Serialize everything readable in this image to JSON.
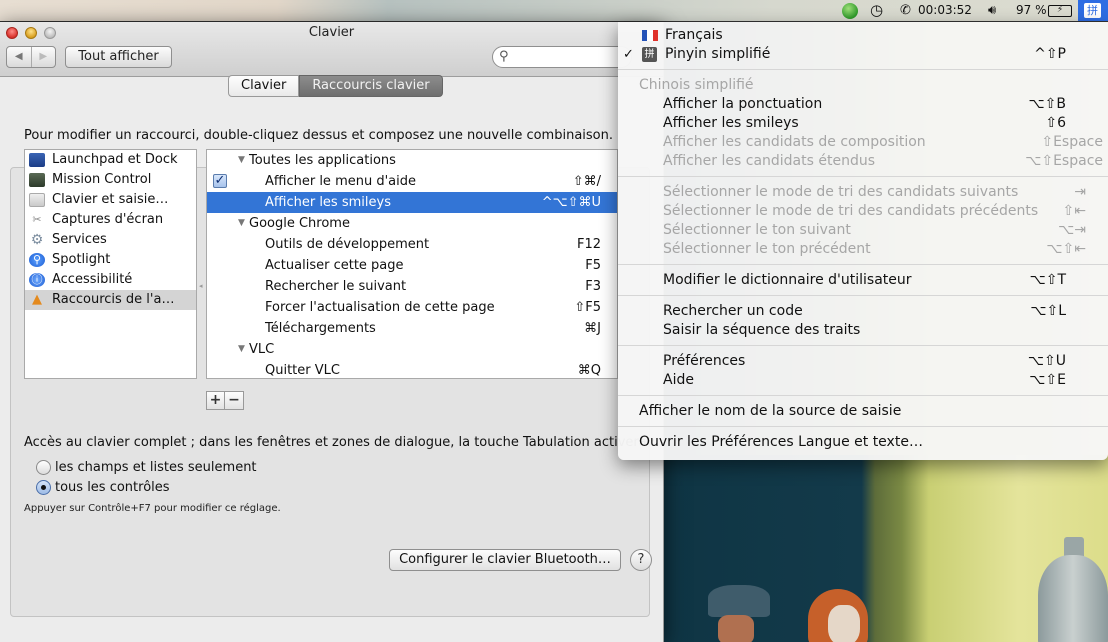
{
  "menubar": {
    "clock_time": "00:03:52",
    "battery_percent": "97 %",
    "input_source_glyph": "拼",
    "icons": [
      "green-status-icon",
      "time-machine-icon",
      "phone-icon",
      "volume-icon",
      "battery-icon",
      "input-source-icon"
    ]
  },
  "window": {
    "title": "Clavier",
    "back_glyph": "◀",
    "forward_glyph": "▶",
    "show_all_label": "Tout afficher",
    "search_placeholder": "",
    "search_glyph": "⚲",
    "tabs": [
      {
        "label": "Clavier",
        "selected": false
      },
      {
        "label": "Raccourcis clavier",
        "selected": true
      }
    ],
    "instructions": "Pour modifier un raccourci, double-cliquez dessus et composez une nouvelle combinaison.",
    "categories": [
      {
        "label": "Launchpad et Dock",
        "icon": "launchpad-icon",
        "selected": false
      },
      {
        "label": "Mission Control",
        "icon": "mission-control-icon",
        "selected": false
      },
      {
        "label": "Clavier et saisie…",
        "icon": "keyboard-icon",
        "selected": false
      },
      {
        "label": "Captures d'écran",
        "icon": "screenshot-icon",
        "selected": false
      },
      {
        "label": "Services",
        "icon": "gear-icon",
        "selected": false
      },
      {
        "label": "Spotlight",
        "icon": "spotlight-icon",
        "selected": false
      },
      {
        "label": "Accessibilité",
        "icon": "accessibility-icon",
        "selected": false
      },
      {
        "label": "Raccourcis de l'a…",
        "icon": "app-shortcuts-icon",
        "selected": true
      }
    ],
    "shortcuts": [
      {
        "type": "group",
        "label": "Toutes les applications"
      },
      {
        "type": "item",
        "label": "Afficher le menu d'aide",
        "key": "⇧⌘/",
        "checked": true,
        "selected": false
      },
      {
        "type": "item",
        "label": "Afficher les smileys",
        "key": "^⌥⇧⌘U",
        "checked": false,
        "selected": true
      },
      {
        "type": "group",
        "label": "Google Chrome"
      },
      {
        "type": "item",
        "label": "Outils de développement",
        "key": "F12"
      },
      {
        "type": "item",
        "label": "Actualiser cette page",
        "key": "F5"
      },
      {
        "type": "item",
        "label": "Rechercher le suivant",
        "key": "F3"
      },
      {
        "type": "item",
        "label": "Forcer l'actualisation de cette page",
        "key": "⇧F5"
      },
      {
        "type": "item",
        "label": "Téléchargements",
        "key": "⌘J"
      },
      {
        "type": "group",
        "label": "VLC"
      },
      {
        "type": "item",
        "label": "Quitter VLC",
        "key": "⌘Q"
      }
    ],
    "add_label": "+",
    "remove_label": "−",
    "full_keyboard_access_label": "Accès au clavier complet ; dans les fenêtres et zones de dialogue, la touche Tabulation activera :",
    "radio_options": [
      {
        "label": "les champs et listes seulement",
        "selected": false
      },
      {
        "label": "tous les contrôles",
        "selected": true
      }
    ],
    "hint": "Appuyer sur Contrôle+F7 pour modifier ce réglage.",
    "bluetooth_button": "Configurer le clavier Bluetooth…",
    "help_button": "?"
  },
  "input_menu": {
    "sources": [
      {
        "label": "Français",
        "icon": "french-flag-icon",
        "checked": false,
        "key": ""
      },
      {
        "label": "Pinyin simplifié",
        "icon": "pinyin-icon",
        "checked": true,
        "key": "^⇧P"
      }
    ],
    "check_glyph": "✓",
    "pinyin_glyph": "拼",
    "section_header": "Chinois simplifié",
    "group1": [
      {
        "label": "Afficher la ponctuation",
        "key": "⌥⇧B",
        "enabled": true
      },
      {
        "label": "Afficher les smileys",
        "key": "⇧6",
        "enabled": true
      },
      {
        "label": "Afficher les candidats de composition",
        "key": "⇧Espace",
        "enabled": false
      },
      {
        "label": "Afficher les candidats étendus",
        "key": "⌥⇧Espace",
        "enabled": false
      }
    ],
    "group2": [
      {
        "label": "Sélectionner le mode de tri des candidats suivants",
        "key": "⇥",
        "enabled": false
      },
      {
        "label": "Sélectionner le mode de tri des candidats précédents",
        "key": "⇧⇤",
        "enabled": false
      },
      {
        "label": "Sélectionner le ton suivant",
        "key": "⌥⇥",
        "enabled": false
      },
      {
        "label": "Sélectionner le ton précédent",
        "key": "⌥⇧⇤",
        "enabled": false
      }
    ],
    "group3": [
      {
        "label": "Modifier le dictionnaire d'utilisateur",
        "key": "⌥⇧T",
        "enabled": true
      }
    ],
    "group4": [
      {
        "label": "Rechercher un code",
        "key": "⌥⇧L",
        "enabled": true
      },
      {
        "label": "Saisir la séquence des traits",
        "key": "",
        "enabled": true
      }
    ],
    "group5": [
      {
        "label": "Préférences",
        "key": "⌥⇧U",
        "enabled": true
      },
      {
        "label": "Aide",
        "key": "⌥⇧E",
        "enabled": true
      }
    ],
    "show_source_name": "Afficher le nom de la source de saisie",
    "open_prefs": "Ouvrir les Préférences Langue et texte…"
  },
  "colors": {
    "selection_blue": "#3375d6",
    "menubar_input_highlight": "#2e6de3",
    "disabled_text": "#a6a6a6"
  }
}
